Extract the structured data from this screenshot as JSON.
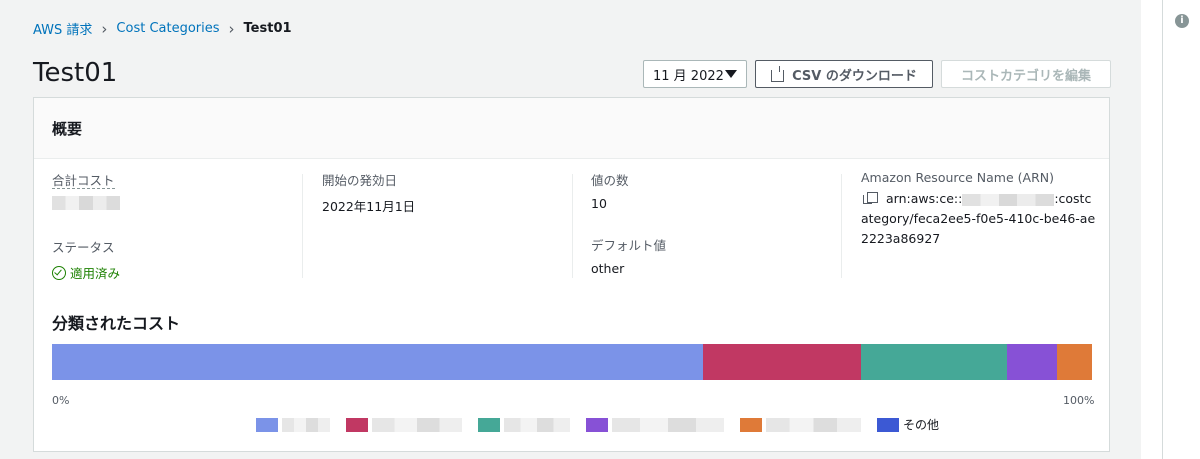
{
  "breadcrumb": {
    "items": [
      "AWS 請求",
      "Cost Categories"
    ],
    "current": "Test01"
  },
  "page": {
    "title": "Test01"
  },
  "toolbar": {
    "month_select": "11 月 2022",
    "csv_button": "CSV のダウンロード",
    "edit_button": "コストカテゴリを編集"
  },
  "overview": {
    "title": "概要",
    "total_cost_label": "合計コスト",
    "status_label": "ステータス",
    "status_value": "適用済み",
    "start_label": "開始の発効日",
    "start_value": "2022年11月1日",
    "count_label": "値の数",
    "count_value": "10",
    "default_label": "デフォルト値",
    "default_value": "other",
    "arn_label": "Amazon Resource Name (ARN)",
    "arn_prefix": "arn:aws:ce::",
    "arn_suffix": ":costcategory/feca2ee5-f0e5-410c-be46-ae2223a86927"
  },
  "categorized": {
    "title": "分類されたコスト",
    "tick_start": "0%",
    "tick_end": "100%",
    "other_label": "その他"
  },
  "chart_data": {
    "type": "bar",
    "orientation": "horizontal-stacked",
    "title": "分類されたコスト",
    "xlim": [
      0,
      100
    ],
    "series": [
      {
        "name": "",
        "value": 62.6,
        "color": "#7b93e8"
      },
      {
        "name": "",
        "value": 15.2,
        "color": "#c13863"
      },
      {
        "name": "",
        "value": 14.0,
        "color": "#45a897"
      },
      {
        "name": "",
        "value": 4.8,
        "color": "#8751d6"
      },
      {
        "name": "",
        "value": 3.4,
        "color": "#df7a38"
      }
    ],
    "legend": [
      "",
      "",
      "",
      "",
      "",
      "その他"
    ],
    "legend_colors": [
      "#7b93e8",
      "#c13863",
      "#45a897",
      "#8751d6",
      "#df7a38",
      "#3c59d4"
    ]
  },
  "colors": {
    "link": "#0073bb",
    "success": "#1d8102",
    "border": "#d5dbdb"
  }
}
